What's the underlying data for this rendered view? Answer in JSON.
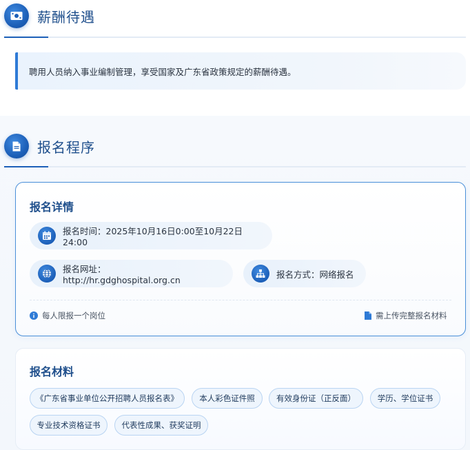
{
  "salary_section": {
    "title": "薪酬待遇",
    "icon": "money-icon",
    "notice": "聘用人员纳入事业编制管理，享受国家及广东省政策规定的薪酬待遇。"
  },
  "registration_section": {
    "title": "报名程序",
    "icon": "document-icon",
    "details_card": {
      "title": "报名详情",
      "time": {
        "icon": "calendar-icon",
        "text": "报名时间：2025年10月16日0:00至10月22日24:00"
      },
      "website": {
        "icon": "globe-icon",
        "text": "报名网址：http://hr.gdghospital.org.cn"
      },
      "method": {
        "icon": "sitemap-icon",
        "text": "报名方式：网络报名"
      },
      "footer_left": {
        "icon": "info-icon",
        "text": "每人限报一个岗位"
      },
      "footer_right": {
        "icon": "file-icon",
        "text": "需上传完整报名材料"
      }
    },
    "materials_card": {
      "title": "报名材料",
      "tags": [
        "《广东省事业单位公开招聘人员报名表》",
        "本人彩色证件照",
        "有效身份证（正反面）",
        "学历、学位证书",
        "专业技术资格证书",
        "代表性成果、获奖证明"
      ]
    }
  },
  "colors": {
    "primary": "#1c5fb8",
    "title_text": "#1f4f8c",
    "accent_border": "#2e7ad6"
  }
}
